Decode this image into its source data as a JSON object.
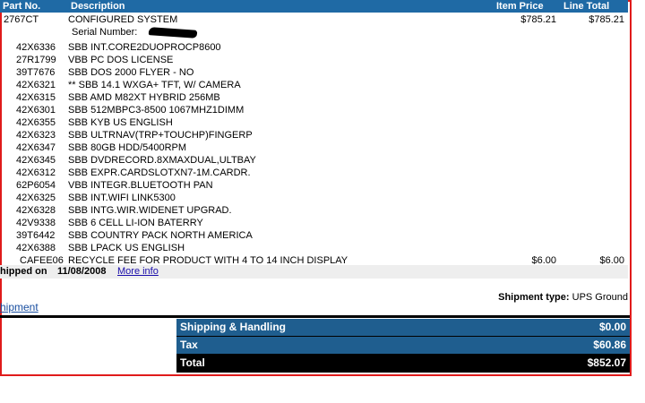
{
  "header": {
    "part_no": "Part No.",
    "description": "Description",
    "item_price": "Item Price",
    "line_total": "Line Total"
  },
  "main_item": {
    "part_no": "2767CT",
    "description": "CONFIGURED SYSTEM",
    "item_price": "$785.21",
    "line_total": "$785.21",
    "serial_label": "Serial Number:"
  },
  "components": [
    {
      "part_no": "42X6336",
      "description": "SBB INT.CORE2DUOPROCP8600"
    },
    {
      "part_no": "27R1799",
      "description": "VBB PC DOS LICENSE"
    },
    {
      "part_no": "39T7676",
      "description": "SBB DOS 2000 FLYER - NO"
    },
    {
      "part_no": "42X6321",
      "description": "** SBB 14.1 WXGA+ TFT, W/ CAMERA"
    },
    {
      "part_no": "42X6315",
      "description": "SBB AMD M82XT HYBRID 256MB"
    },
    {
      "part_no": "42X6301",
      "description": "SBB 512MBPC3-8500 1067MHZ1DIMM"
    },
    {
      "part_no": "42X6355",
      "description": "SBB KYB US ENGLISH"
    },
    {
      "part_no": "42X6323",
      "description": "SBB ULTRNAV(TRP+TOUCHP)FINGERP"
    },
    {
      "part_no": "42X6347",
      "description": "SBB 80GB HDD/5400RPM"
    },
    {
      "part_no": "42X6345",
      "description": "SBB DVDRECORD.8XMAXDUAL,ULTBAY"
    },
    {
      "part_no": "42X6312",
      "description": "SBB EXPR.CARDSLOTXN7-1M.CARDR."
    },
    {
      "part_no": "62P6054",
      "description": "VBB INTEGR.BLUETOOTH PAN"
    },
    {
      "part_no": "42X6325",
      "description": "SBB INT.WIFI LINK5300"
    },
    {
      "part_no": "42X6328",
      "description": "SBB INTG.WIR.WIDENET UPGRAD."
    },
    {
      "part_no": "42V9338",
      "description": "SBB 6 CELL LI-ION BATERRY"
    },
    {
      "part_no": "39T6442",
      "description": "SBB COUNTRY PACK NORTH AMERICA"
    },
    {
      "part_no": "42X6388",
      "description": "SBB LPACK US ENGLISH"
    }
  ],
  "fee_item": {
    "part_no": "CAFEE06",
    "description": "RECYCLE FEE FOR PRODUCT WITH 4 TO 14 INCH DISPLAY",
    "item_price": "$6.00",
    "line_total": "$6.00"
  },
  "shipment": {
    "shipped_label": "hipped on",
    "date": "11/08/2008",
    "more_info": "More info",
    "type_label": "Shipment type:",
    "type_value": "UPS Ground",
    "link": "hipment"
  },
  "totals": [
    {
      "label": "Shipping & Handling",
      "value": "$0.00"
    },
    {
      "label": "Tax",
      "value": "$60.86"
    },
    {
      "label": "Total",
      "value": "$852.07"
    }
  ],
  "colors": {
    "header_bg": "#1f6aa5",
    "totals_bg": "#1f5e8f",
    "border": "#e01b1b"
  }
}
